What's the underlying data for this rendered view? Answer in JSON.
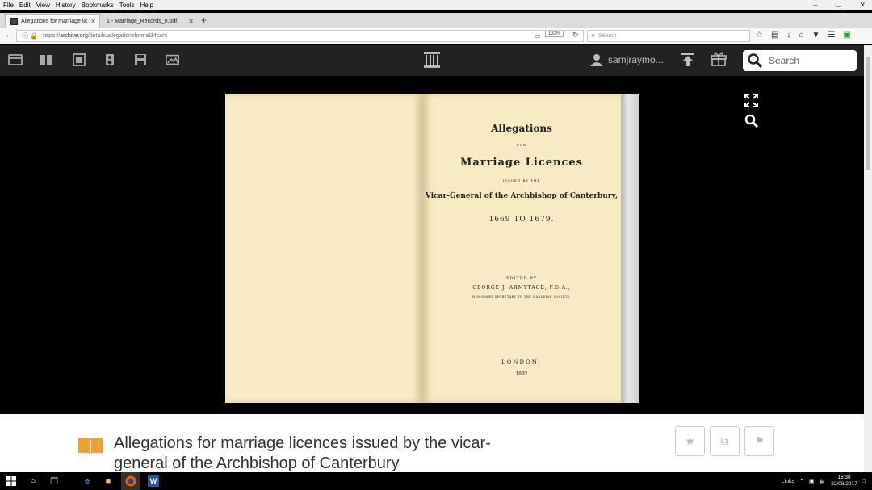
{
  "menu": [
    "File",
    "Edit",
    "View",
    "History",
    "Bookmarks",
    "Tools",
    "Help"
  ],
  "tabs": [
    {
      "label": "Allegations for marriage lic"
    },
    {
      "label": "1 - Marriage_Records_0.pdf"
    }
  ],
  "nav": {
    "url_scheme": "https://",
    "url_host": "archive.org",
    "url_path": "/details/allegationsformal34cant",
    "zoom": "133%",
    "search_placeholder": "Search"
  },
  "ia_toolbar": {
    "icons": [
      "web-icon",
      "texts-icon",
      "video-icon",
      "audio-icon",
      "software-icon",
      "images-icon"
    ],
    "username": "samjraymo...",
    "search_placeholder": "Search"
  },
  "book_page": {
    "line1": "Allegations",
    "line2": "FOR",
    "line3": "Marriage Licences",
    "line4": "ISSUED BY THE",
    "line5": "Vicar-General of the Archbishop of Canterbury,",
    "line6": "1669 TO 1679.",
    "line7": "EDITED BY",
    "line8": "GEORGE J. ARMYTAGE, F.S.A.,",
    "line9": "HONORARY SECRETARY TO THE HARLEIAN SOCIETY.",
    "line10": "LONDON:",
    "line11": "1892"
  },
  "item": {
    "title": "Allegations for marriage licences issued by the vicar-general of the Archbishop of Canterbury"
  },
  "taskbar": {
    "links_label": "Links",
    "time": "16:38",
    "date": "22/08/2017"
  },
  "colors": {
    "ia_bar": "#222222",
    "page": "#f6ebc3",
    "book_icon": "#f0a030"
  }
}
